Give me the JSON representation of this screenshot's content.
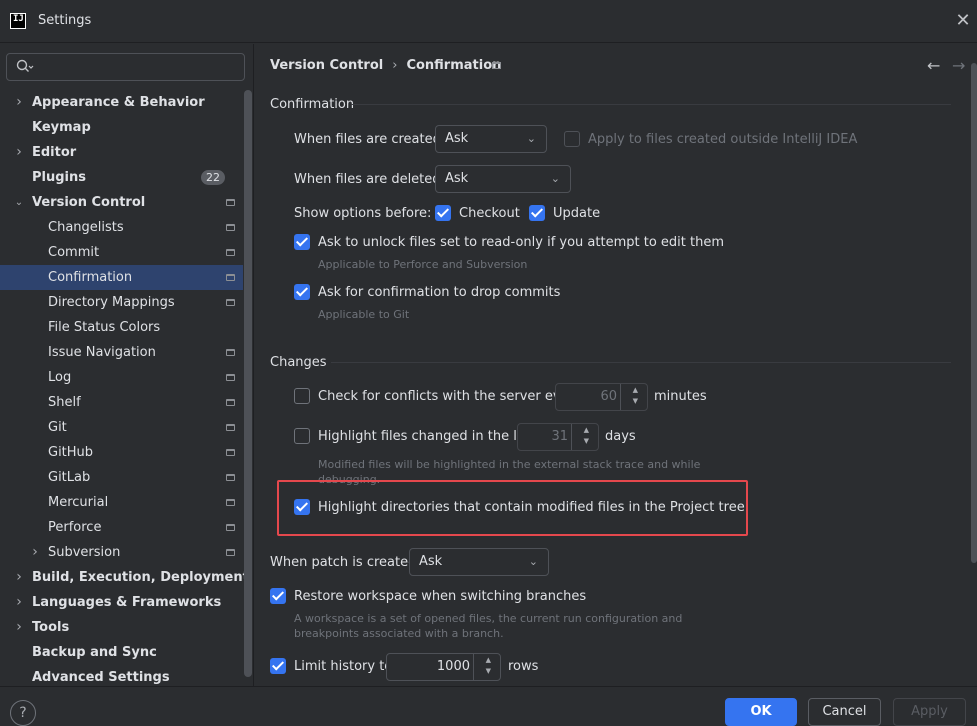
{
  "window": {
    "title": "Settings",
    "logo_text": "IJ"
  },
  "search": {
    "placeholder": ""
  },
  "sidebar": {
    "items": [
      {
        "label": "Appearance & Behavior",
        "bold": true,
        "arrow": "right",
        "indent": 0
      },
      {
        "label": "Keymap",
        "bold": true,
        "arrow": "",
        "indent": 0
      },
      {
        "label": "Editor",
        "bold": true,
        "arrow": "right",
        "indent": 0
      },
      {
        "label": "Plugins",
        "bold": true,
        "arrow": "",
        "indent": 0,
        "badge": "22"
      },
      {
        "label": "Version Control",
        "bold": true,
        "arrow": "down",
        "indent": 0,
        "pin": true
      },
      {
        "label": "Changelists",
        "indent": 1,
        "pin": true
      },
      {
        "label": "Commit",
        "indent": 1,
        "pin": true
      },
      {
        "label": "Confirmation",
        "indent": 1,
        "pin": true,
        "selected": true
      },
      {
        "label": "Directory Mappings",
        "indent": 1,
        "pin": true
      },
      {
        "label": "File Status Colors",
        "indent": 1
      },
      {
        "label": "Issue Navigation",
        "indent": 1,
        "pin": true
      },
      {
        "label": "Log",
        "indent": 1,
        "pin": true
      },
      {
        "label": "Shelf",
        "indent": 1,
        "pin": true
      },
      {
        "label": "Git",
        "indent": 1,
        "pin": true
      },
      {
        "label": "GitHub",
        "indent": 1,
        "pin": true
      },
      {
        "label": "GitLab",
        "indent": 1,
        "pin": true
      },
      {
        "label": "Mercurial",
        "indent": 1,
        "pin": true
      },
      {
        "label": "Perforce",
        "indent": 1,
        "pin": true
      },
      {
        "label": "Subversion",
        "indent": 1,
        "pin": true,
        "arrow": "right"
      },
      {
        "label": "Build, Execution, Deployment",
        "bold": true,
        "arrow": "right",
        "indent": 0
      },
      {
        "label": "Languages & Frameworks",
        "bold": true,
        "arrow": "right",
        "indent": 0
      },
      {
        "label": "Tools",
        "bold": true,
        "arrow": "right",
        "indent": 0
      },
      {
        "label": "Backup and Sync",
        "bold": true,
        "arrow": "",
        "indent": 0
      },
      {
        "label": "Advanced Settings",
        "bold": true,
        "arrow": "",
        "indent": 0
      }
    ]
  },
  "breadcrumb": {
    "parent": "Version Control",
    "separator": "›",
    "current": "Confirmation"
  },
  "nav": {
    "back": "←",
    "forward": "→"
  },
  "confirmation": {
    "section_title": "Confirmation",
    "files_created_label": "When files are created:",
    "files_created_value": "Ask",
    "apply_outside_label": "Apply to files created outside IntelliJ IDEA",
    "apply_outside_checked": false,
    "files_deleted_label": "When files are deleted:",
    "files_deleted_value": "Ask",
    "show_options_label": "Show options before:",
    "checkout_label": "Checkout",
    "checkout_checked": true,
    "update_label": "Update",
    "update_checked": true,
    "unlock_label": "Ask to unlock files set to read-only if you attempt to edit them",
    "unlock_checked": true,
    "unlock_hint": "Applicable to Perforce and Subversion",
    "drop_commits_label": "Ask for confirmation to drop commits",
    "drop_commits_checked": true,
    "drop_commits_hint": "Applicable to Git"
  },
  "changes": {
    "section_title": "Changes",
    "conflicts_label": "Check for conflicts with the server every",
    "conflicts_checked": false,
    "conflicts_value": "60",
    "conflicts_unit": "minutes",
    "highlight_changed_label": "Highlight files changed in the last",
    "highlight_changed_checked": false,
    "highlight_changed_value": "31",
    "highlight_changed_unit": "days",
    "highlight_changed_hint_line1": "Modified files will be highlighted in the external stack trace and while",
    "highlight_changed_hint_line2": "debugging.",
    "highlight_dirs_label": "Highlight directories that contain modified files in the Project tree",
    "highlight_dirs_checked": true
  },
  "patch": {
    "label": "When patch is created:",
    "value": "Ask"
  },
  "restore": {
    "label": "Restore workspace when switching branches",
    "checked": true,
    "hint_line1": "A workspace is a set of opened files, the current run configuration and",
    "hint_line2": "breakpoints associated with a branch."
  },
  "history": {
    "label": "Limit history to",
    "checked": true,
    "value": "1000",
    "unit": "rows"
  },
  "footer": {
    "help": "?",
    "ok": "OK",
    "cancel": "Cancel",
    "apply": "Apply"
  },
  "colors": {
    "accent": "#3574f0",
    "selection": "#2e436e",
    "highlight_box": "#e5484d"
  }
}
